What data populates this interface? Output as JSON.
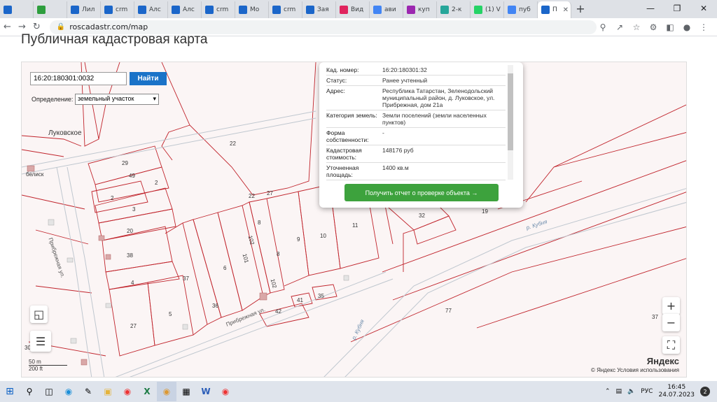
{
  "browser": {
    "tabs": [
      {
        "label": "",
        "icon": "cadastre-icon",
        "color": "#1b66c9"
      },
      {
        "label": "",
        "icon": "green-logo-icon",
        "color": "#2e9e3e"
      },
      {
        "label": "Лил",
        "icon": "cadastre-icon",
        "color": "#1b66c9"
      },
      {
        "label": "crm",
        "icon": "cadastre-icon",
        "color": "#1b66c9"
      },
      {
        "label": "Алс",
        "icon": "cadastre-icon",
        "color": "#1b66c9"
      },
      {
        "label": "Алс",
        "icon": "cadastre-icon",
        "color": "#1b66c9"
      },
      {
        "label": "crm",
        "icon": "cadastre-icon",
        "color": "#1b66c9"
      },
      {
        "label": "Мо",
        "icon": "cadastre-icon",
        "color": "#1b66c9"
      },
      {
        "label": "crm",
        "icon": "cadastre-icon",
        "color": "#1b66c9"
      },
      {
        "label": "Зая",
        "icon": "cadastre-icon",
        "color": "#1b66c9"
      },
      {
        "label": "Вид",
        "icon": "video-icon",
        "color": "#e0245e"
      },
      {
        "label": "ави",
        "icon": "google-icon",
        "color": "#4285f4"
      },
      {
        "label": "куп",
        "icon": "flower-icon",
        "color": "#9c27b0"
      },
      {
        "label": "2-к",
        "icon": "flower-icon",
        "color": "#26a69a"
      },
      {
        "label": "(1) V",
        "icon": "whatsapp-icon",
        "color": "#25d366"
      },
      {
        "label": "пуб",
        "icon": "google-icon",
        "color": "#4285f4"
      },
      {
        "label": "П",
        "icon": "cadastre-icon",
        "color": "#1b66c9",
        "active": true
      }
    ],
    "new_tab": "+",
    "url": "roscadastr.com/map"
  },
  "page": {
    "title": "Публичная кадастровая карта"
  },
  "search": {
    "value": "16:20:180301:0032",
    "button": "Найти",
    "def_label": "Определение:",
    "def_value": "земельный участок"
  },
  "popup": {
    "rows": [
      {
        "k": "Кад. номер:",
        "v": "16:20:180301:32"
      },
      {
        "k": "Статус:",
        "v": "Ранее учтенный"
      },
      {
        "k": "Адрес:",
        "v": "Республика Татарстан, Зеленодольский муниципальный район, д. Луковское, ул. Прибрежная, дом 21а"
      },
      {
        "k": "Категория земель:",
        "v": "Земли поселений (земли населенных пунктов)"
      },
      {
        "k": "Форма собственности:",
        "v": "-"
      },
      {
        "k": "Кадастровая стоимость:",
        "v": "148176 руб"
      },
      {
        "k": "Уточненная площадь:",
        "v": "1400 кв.м"
      }
    ],
    "button": "Получить отчет о проверке объекта →"
  },
  "map": {
    "labels": [
      {
        "t": "Луковское"
      },
      {
        "t": "22"
      },
      {
        "t": "29"
      },
      {
        "t": "49"
      },
      {
        "t": "2"
      },
      {
        "t": "2"
      },
      {
        "t": "3"
      },
      {
        "t": "20"
      },
      {
        "t": "38"
      },
      {
        "t": "4"
      },
      {
        "t": "27"
      },
      {
        "t": "5"
      },
      {
        "t": "37"
      },
      {
        "t": "36"
      },
      {
        "t": "6"
      },
      {
        "t": "101"
      },
      {
        "t": "102"
      },
      {
        "t": "102"
      },
      {
        "t": "8"
      },
      {
        "t": "8"
      },
      {
        "t": "9"
      },
      {
        "t": "10"
      },
      {
        "t": "11"
      },
      {
        "t": "22"
      },
      {
        "t": "27"
      },
      {
        "t": "32"
      },
      {
        "t": "19"
      },
      {
        "t": "42"
      },
      {
        "t": "41"
      },
      {
        "t": "35"
      },
      {
        "t": "77"
      },
      {
        "t": "37"
      },
      {
        "t": "30"
      },
      {
        "t": "белиск"
      },
      {
        "t": "Прибрежная ул."
      },
      {
        "t": "Прибрежная ул."
      },
      {
        "t": "р. Кубня"
      },
      {
        "t": "р. Кубня"
      }
    ],
    "zoom_in": "+",
    "zoom_out": "−",
    "scale_m": "50 m",
    "scale_ft": "200 ft",
    "brand": "Яндекс",
    "attribution": "© Яндекс  Условия использования"
  },
  "taskbar": {
    "lang": "РУС",
    "time": "16:45",
    "date": "24.07.2023",
    "notif": "2"
  }
}
